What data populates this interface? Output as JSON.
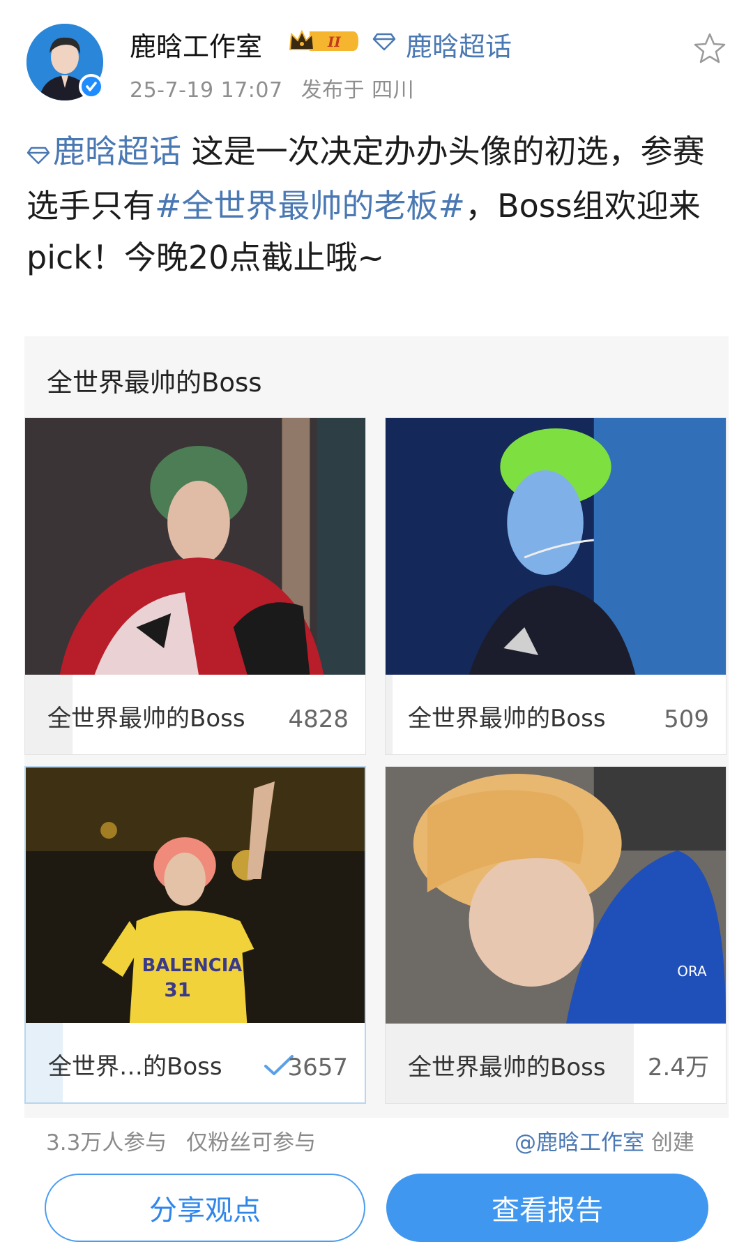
{
  "post": {
    "author": "鹿晗工作室",
    "topic_tag": "鹿晗超话",
    "time": "25-7-19 17:07",
    "location": "发布于 四川",
    "text_topic": "鹿晗超话",
    "text_part1": " 这是一次决定办办头像的初选，参赛选手只有",
    "text_hashtag": "#全世界最帅的老板#",
    "text_part2": "，Boss组欢迎来pick！今晚20点截止哦~"
  },
  "vote": {
    "title": "全世界最帅的Boss",
    "options": [
      {
        "label": "全世界最帅的Boss",
        "count": "4828",
        "share": 0.14,
        "selected": false
      },
      {
        "label": "全世界最帅的Boss",
        "count": "509",
        "share": 0.02,
        "selected": false
      },
      {
        "label": "全世界…的Boss",
        "count": "3657",
        "share": 0.11,
        "selected": true
      },
      {
        "label": "全世界最帅的Boss",
        "count": "2.4万",
        "share": 0.73,
        "selected": false
      }
    ],
    "participants": "3.3万人参与",
    "restriction": "仅粉丝可参与",
    "creator": "@鹿晗工作室",
    "creator_suffix": " 创建",
    "share_button": "分享观点",
    "report_button": "查看报告"
  },
  "colors": {
    "link": "#4a78b3",
    "primary": "#3f97f0",
    "check": "#5aa0e6"
  },
  "icons": [
    "verified-icon",
    "crown-badge-icon",
    "diamond-icon",
    "star-icon",
    "check-icon"
  ]
}
